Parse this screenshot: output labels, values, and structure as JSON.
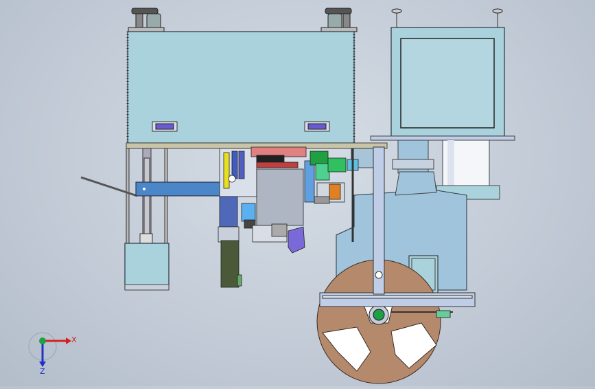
{
  "viewport": {
    "background": "#c6ced9"
  },
  "triad": {
    "x_label": "X",
    "z_label": "Z",
    "x_color": "#d62020",
    "z_color": "#2030c8",
    "origin_color": "#20a040"
  },
  "colors": {
    "panel": "#a9d2dc",
    "panel_stroke": "#2a3440",
    "lightblue": "#9fc4dc",
    "rail": "#bfcde6",
    "wheel": "#b58a6c",
    "handle": "#7a6ad8",
    "arm_blue": "#4a86c8"
  }
}
